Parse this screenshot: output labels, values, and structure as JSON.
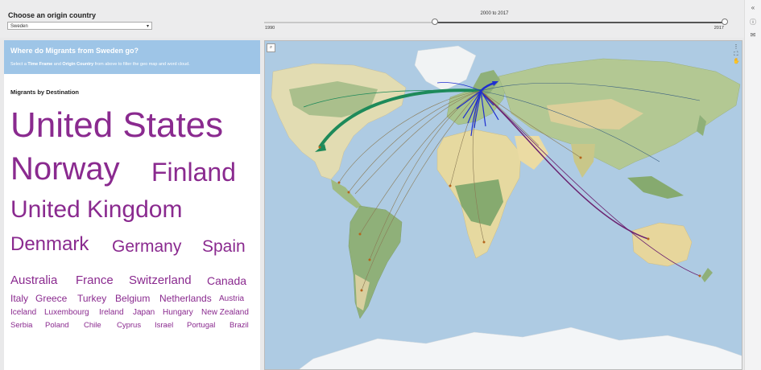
{
  "filters": {
    "origin_label": "Choose an origin country",
    "origin_value": "Sweden",
    "timeframe_range_label": "2000 to 2017",
    "timeframe_min": "1990",
    "timeframe_max": "2017",
    "timeframe_start_value": 2000,
    "timeframe_end_value": 2017
  },
  "banner": {
    "title": "Where do Migrants from Sweden go?",
    "sub_pre": "Select a ",
    "sub_b1": "Time Frame",
    "sub_mid": " and ",
    "sub_b2": "Origin Country",
    "sub_post": " from above to filter the geo map and word cloud."
  },
  "cloud": {
    "title": "Migrants by Destination",
    "words": [
      "United States",
      "Norway",
      "Finland",
      "United Kingdom",
      "Denmark",
      "Germany",
      "Spain",
      "Australia",
      "France",
      "Switzerland",
      "Canada",
      "Italy",
      "Greece",
      "Turkey",
      "Belgium",
      "Netherlands",
      "Austria",
      "Iceland",
      "Luxembourg",
      "Ireland",
      "Japan",
      "Hungary",
      "New Zealand",
      "Serbia",
      "Poland",
      "Chile",
      "Cyprus",
      "Israel",
      "Portugal",
      "Brazil"
    ]
  },
  "map": {
    "search_icon": "search-icon",
    "tools": [
      "more-options-icon",
      "fullscreen-icon",
      "pan-hand-icon"
    ],
    "colors": {
      "ocean": "#aecbe3",
      "land": "#e3dcb3",
      "forest": "#8fb07a",
      "ice": "#f4f6f8",
      "flow_main": "#1e8a5a",
      "flow_blue": "#1f2fd0",
      "flow_purple": "#6b2270",
      "flow_gray": "#8a7a55"
    }
  },
  "rail": {
    "icons": [
      "collapse-icon",
      "info-icon",
      "comment-icon"
    ]
  }
}
